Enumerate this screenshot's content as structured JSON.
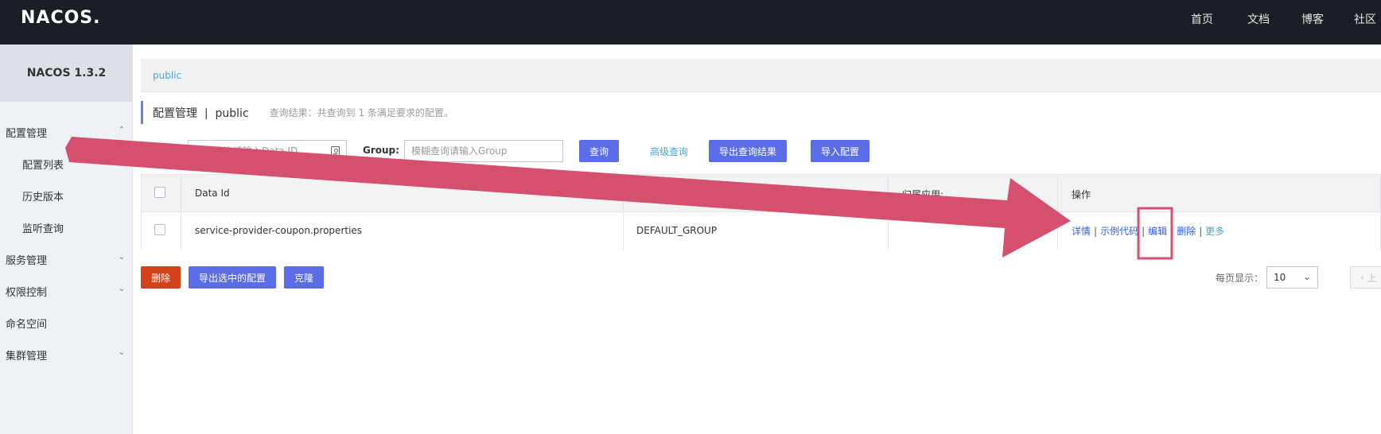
{
  "topbar": {
    "logo": "NACOS.",
    "nav": [
      "首页",
      "文档",
      "博客",
      "社区"
    ]
  },
  "sidebar": {
    "version": "NACOS 1.3.2",
    "items": [
      {
        "label": "配置管理",
        "level": "top",
        "expanded": true
      },
      {
        "label": "配置列表",
        "level": "sub",
        "selected": true
      },
      {
        "label": "历史版本",
        "level": "sub"
      },
      {
        "label": "监听查询",
        "level": "sub"
      },
      {
        "label": "服务管理",
        "level": "top",
        "expanded": false
      },
      {
        "label": "权限控制",
        "level": "top",
        "expanded": false
      },
      {
        "label": "命名空间",
        "level": "top"
      },
      {
        "label": "集群管理",
        "level": "top",
        "expanded": false
      }
    ]
  },
  "namespace_bar": {
    "current": "public"
  },
  "page": {
    "title": "配置管理  |  public",
    "result_text": "查询结果：共查询到 1 条满足要求的配置。"
  },
  "filters": {
    "data_id_label": "Data ID:",
    "data_id_placeholder": "模糊查询请输入Data ID",
    "data_id_value": "",
    "group_label": "Group:",
    "group_placeholder": "模糊查询请输入Group",
    "group_value": "",
    "query_button": "查询",
    "advanced_query": "高级查询",
    "export_results_button": "导出查询结果",
    "import_button": "导入配置"
  },
  "table": {
    "columns": [
      "Data Id",
      "",
      "归属应用:",
      "操作"
    ],
    "rows": [
      {
        "data_id": "service-provider-coupon.properties",
        "group": "DEFAULT_GROUP",
        "app": "",
        "actions": [
          "详情",
          "示例代码",
          "编辑",
          "删除",
          "更多"
        ]
      }
    ]
  },
  "bottom": {
    "delete_button": "删除",
    "export_selected_button": "导出选中的配置",
    "clone_button": "克隆",
    "page_size_label": "每页显示：",
    "page_size_value": "10",
    "prev_label": "上"
  },
  "colors": {
    "primary": "#5b6de6",
    "danger": "#d2431c",
    "link": "#47a3d8",
    "annotation": "#d4506e"
  }
}
